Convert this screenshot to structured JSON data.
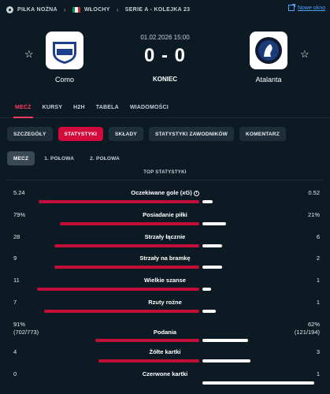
{
  "breadcrumb": {
    "sport": "PIŁKA NOŻNA",
    "country": "WŁOCHY",
    "league": "SERIE A - KOLEJKA 23",
    "new_window": "Nowe okno"
  },
  "match": {
    "date": "01.02.2026 15:00",
    "score": "0 - 0",
    "status": "KONIEC",
    "home": {
      "name": "Como",
      "logo_text": "COMO",
      "logo_year": "1907"
    },
    "away": {
      "name": "Atalanta",
      "logo_text": "ATALANTA"
    }
  },
  "tabs": [
    "MECZ",
    "KURSY",
    "H2H",
    "TABELA",
    "WIADOMOŚCI"
  ],
  "subtabs": [
    "SZCZEGÓŁY",
    "STATYSTYKI",
    "SKŁADY",
    "STATYSTYKI ZAWODNIKÓW",
    "KOMENTARZ"
  ],
  "periods": [
    "MECZ",
    "1. POŁOWA",
    "2. POŁOWA"
  ],
  "section_title": "TOP STATYSTYKI",
  "stats": [
    {
      "name": "Oczekiwane gole (xG)",
      "home": "5.24",
      "away": "0.52",
      "home_sub": "",
      "away_sub": "",
      "home_share": 0.91,
      "away_share": 0.09,
      "info": "i"
    },
    {
      "name": "Posiadanie piłki",
      "home": "79%",
      "away": "21%",
      "home_sub": "",
      "away_sub": "",
      "home_share": 0.79,
      "away_share": 0.21
    },
    {
      "name": "Strzały łącznie",
      "home": "28",
      "away": "6",
      "home_sub": "",
      "away_sub": "",
      "home_share": 0.82,
      "away_share": 0.18
    },
    {
      "name": "Strzały na bramkę",
      "home": "9",
      "away": "2",
      "home_sub": "",
      "away_sub": "",
      "home_share": 0.82,
      "away_share": 0.18
    },
    {
      "name": "Wielkie szanse",
      "home": "11",
      "away": "1",
      "home_sub": "",
      "away_sub": "",
      "home_share": 0.92,
      "away_share": 0.08
    },
    {
      "name": "Rzuty rożne",
      "home": "7",
      "away": "1",
      "home_sub": "",
      "away_sub": "",
      "home_share": 0.88,
      "away_share": 0.12
    },
    {
      "name": "Podania",
      "home": "91%",
      "away": "62%",
      "home_sub": "(702/773)",
      "away_sub": "(121/194)",
      "home_share": 0.59,
      "away_share": 0.41
    },
    {
      "name": "Żółte kartki",
      "home": "4",
      "away": "3",
      "home_sub": "",
      "away_sub": "",
      "home_share": 0.57,
      "away_share": 0.43
    },
    {
      "name": "Czerwone kartki",
      "home": "0",
      "away": "1",
      "home_sub": "",
      "away_sub": "",
      "home_share": 0.0,
      "away_share": 1.0
    }
  ],
  "colors": {
    "background": "#0b1a23",
    "accent": "#d30a3c",
    "home_bar": "#c20f3a",
    "away_bar": "#ffffff",
    "link": "#4da2ff"
  }
}
